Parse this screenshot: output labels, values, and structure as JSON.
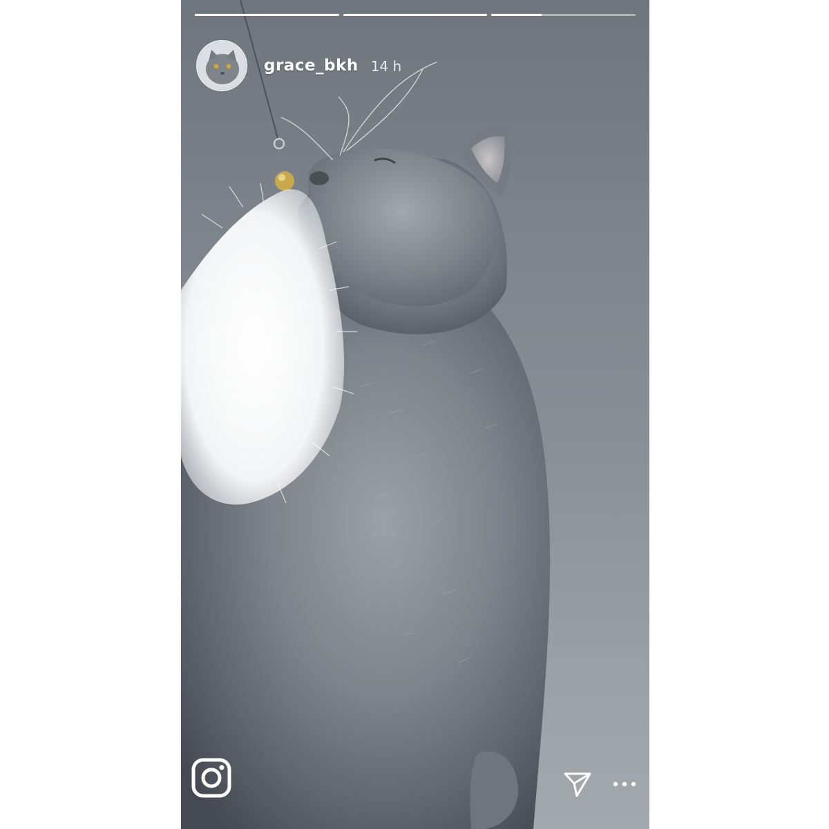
{
  "story": {
    "user": {
      "username": "grace_bkh",
      "timestamp": "14 h"
    },
    "progress": [
      1.0,
      1.0,
      0.35
    ],
    "icons": {
      "camera": "instagram-camera-icon",
      "send": "send-paper-plane-icon",
      "more": "more-options-icon"
    }
  }
}
